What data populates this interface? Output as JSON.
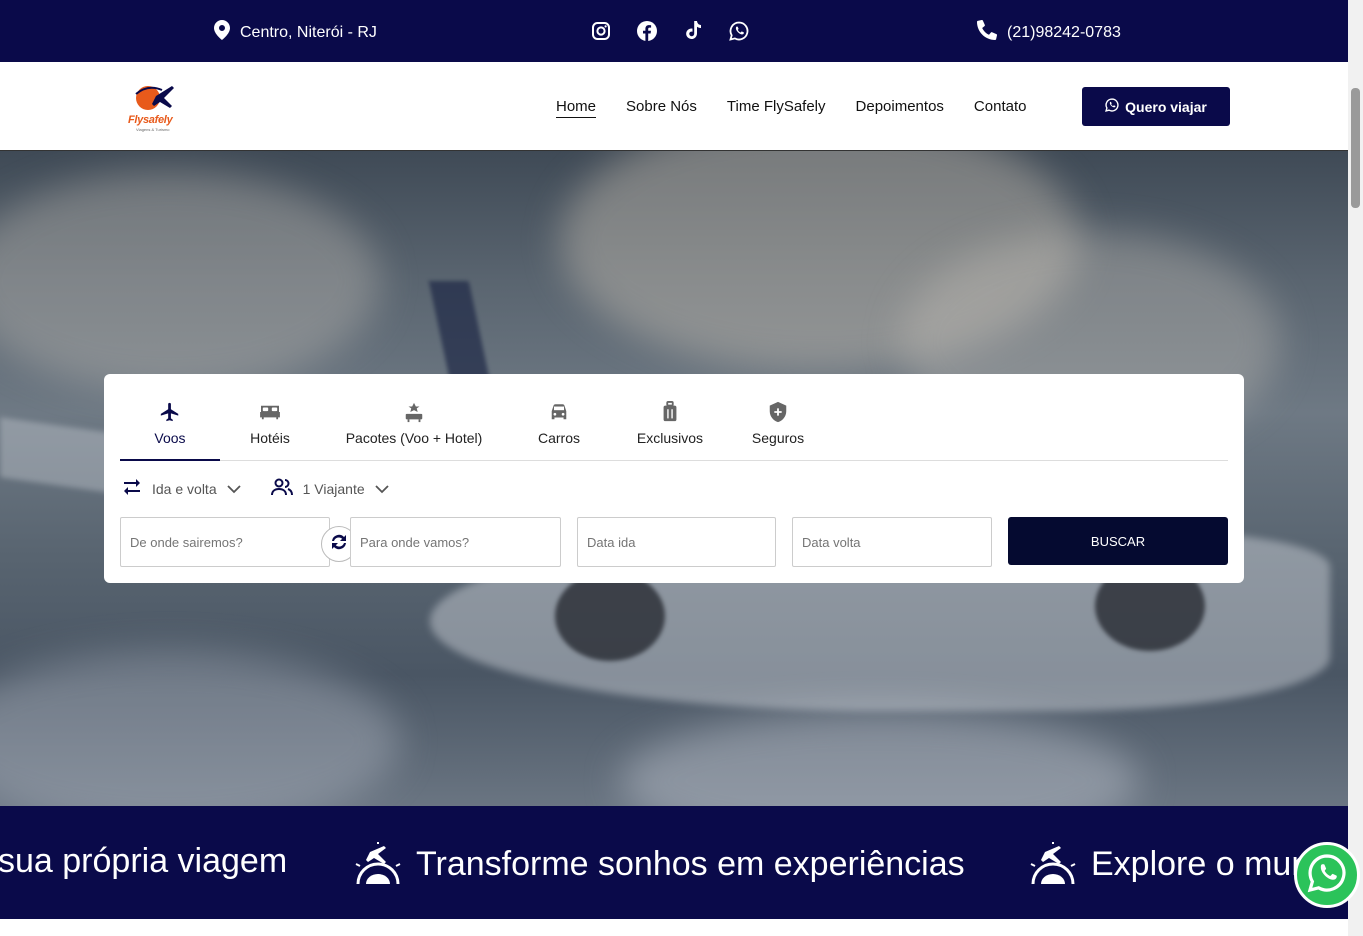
{
  "topbar": {
    "location": "Centro, Niterói - RJ",
    "phone": "(21)98242-0783",
    "socials": [
      "instagram-icon",
      "facebook-icon",
      "tiktok-icon",
      "whatsapp-icon"
    ]
  },
  "header": {
    "logo_text": "Flysafely",
    "logo_sub": "Viagens & Turismo",
    "nav": [
      "Home",
      "Sobre Nós",
      "Time FlySafely",
      "Depoimentos",
      "Contato"
    ],
    "cta": "Quero viajar"
  },
  "search": {
    "tabs": [
      "Voos",
      "Hotéis",
      "Pacotes (Voo + Hotel)",
      "Carros",
      "Exclusivos",
      "Seguros"
    ],
    "active_tab": "Voos",
    "trip_type": "Ida e volta",
    "travelers": "1 Viajante",
    "origin_placeholder": "De onde sairemos?",
    "destination_placeholder": "Para onde vamos?",
    "depart_placeholder": "Data ida",
    "return_placeholder": "Data volta",
    "submit": "BUSCAR"
  },
  "marquee": {
    "items": [
      "sua própria viagem",
      "Transforme sonhos em experiências",
      "Explore o mundo"
    ]
  },
  "colors": {
    "navy": "#0a0a4a",
    "button_dark": "#050a30",
    "whatsapp": "#2bc35a"
  }
}
